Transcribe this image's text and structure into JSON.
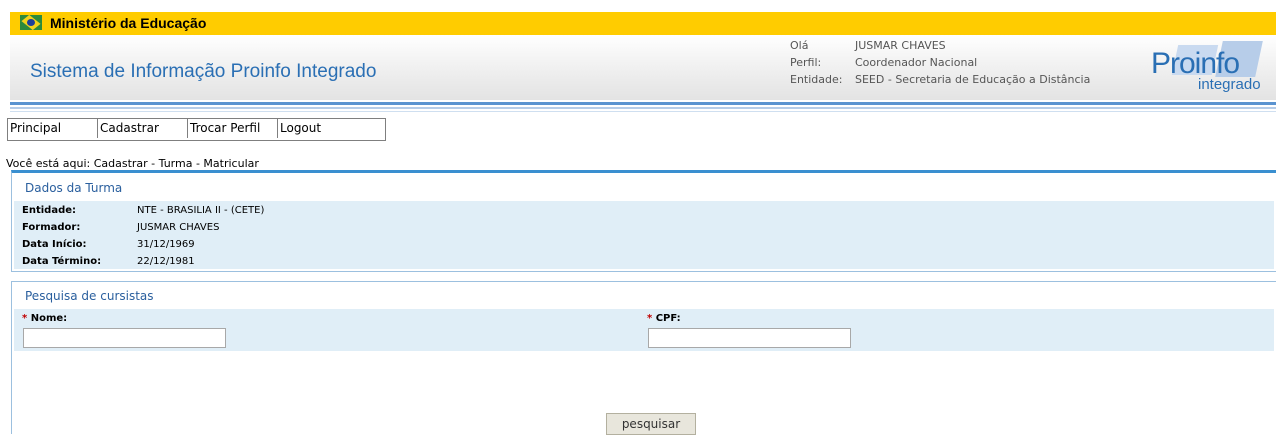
{
  "gov_bar": {
    "title": "Ministério da Educação",
    "flag_icon": "brazil-flag-icon"
  },
  "header": {
    "system_title": "Sistema de Informação Proinfo Integrado",
    "user": {
      "greeting_label": "Olá",
      "name": "JUSMAR CHAVES",
      "profile_label": "Perfil:",
      "profile_value": "Coordenador Nacional",
      "entity_label": "Entidade:",
      "entity_value": "SEED - Secretaria de Educação a Distância"
    },
    "logo": {
      "main": "Proinfo",
      "sub": "integrado"
    }
  },
  "menu": {
    "items": [
      {
        "label": "Principal"
      },
      {
        "label": "Cadastrar"
      },
      {
        "label": "Trocar Perfil"
      },
      {
        "label": "Logout"
      }
    ]
  },
  "breadcrumb": "Você está aqui: Cadastrar - Turma - Matricular",
  "turma": {
    "title": "Dados da Turma",
    "fields": [
      {
        "label": "Entidade:",
        "value": "NTE - BRASILIA II - (CETE)"
      },
      {
        "label": "Formador:",
        "value": "JUSMAR CHAVES"
      },
      {
        "label": "Data Início:",
        "value": "31/12/1969"
      },
      {
        "label": "Data Término:",
        "value": "22/12/1981"
      }
    ]
  },
  "search": {
    "title": "Pesquisa de cursistas",
    "required_mark": "*",
    "nome_label": "Nome:",
    "nome_value": "",
    "cpf_label": "CPF:",
    "cpf_value": "",
    "button_label": "pesquisar"
  },
  "colors": {
    "gov_bar": "#ffcc00",
    "brand_blue": "#2a6fb4",
    "panel_bg": "#e0eef7",
    "required": "#c00000"
  }
}
